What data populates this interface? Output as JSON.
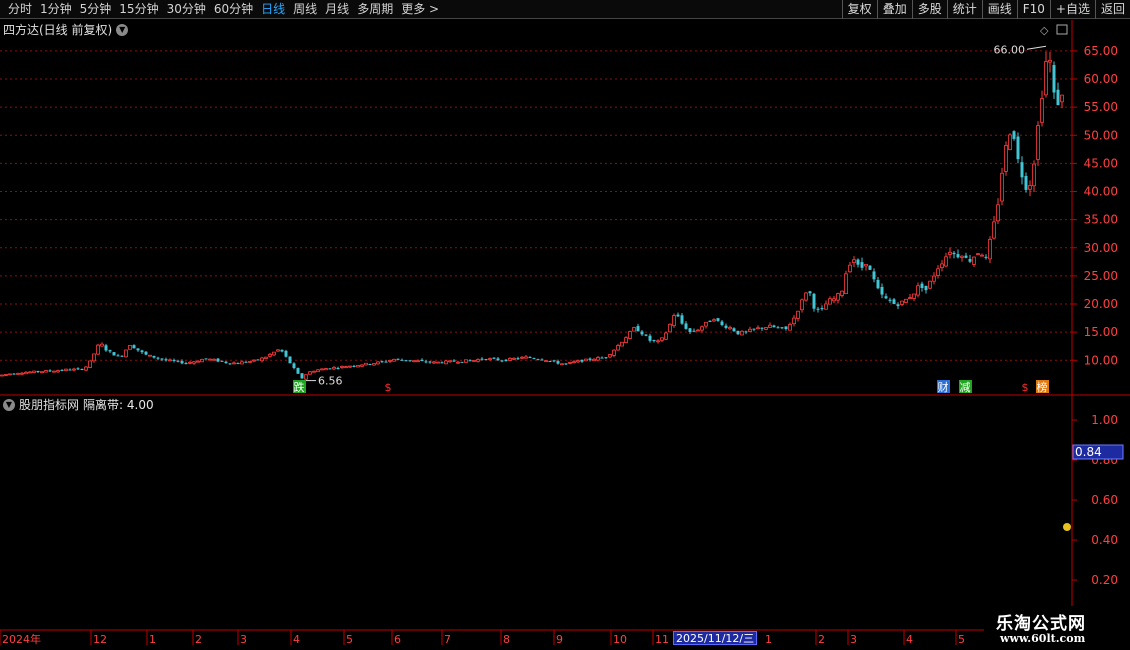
{
  "toolbar": {
    "periods": [
      "分时",
      "1分钟",
      "5分钟",
      "15分钟",
      "30分钟",
      "60分钟",
      "日线",
      "周线",
      "月线",
      "多周期",
      "更多 >"
    ],
    "active_period": "日线",
    "actions": [
      "复权",
      "叠加",
      "多股",
      "统计",
      "画线",
      "F10",
      "+自选",
      "返回"
    ]
  },
  "main_chart": {
    "title": "四方达(日线 前复权)",
    "high_label": "66.00",
    "low_label": "6.56",
    "markers": [
      {
        "text": "跌",
        "color": "#1fa51f"
      },
      {
        "text": "$",
        "color": "#ff3030"
      },
      {
        "text": "财",
        "color": "#2a6fd8"
      },
      {
        "text": "减",
        "color": "#1fa51f"
      },
      {
        "text": "$",
        "color": "#ff3030"
      },
      {
        "text": "榜",
        "color": "#e07a10"
      }
    ]
  },
  "indicator": {
    "name": "股朋指标网",
    "param_label": "隔离带: 4.00",
    "current_value": "0.84"
  },
  "x_axis": {
    "labels": [
      "2024年",
      "12",
      "1",
      "2",
      "3",
      "4",
      "5",
      "6",
      "7",
      "8",
      "9",
      "10",
      "11",
      "1",
      "2",
      "3",
      "4",
      "5"
    ],
    "cursor_date": "2025/11/12/三"
  },
  "watermark": {
    "line1": "乐淘公式网",
    "line2": "www.60lt.com"
  },
  "colors": {
    "up": "#ff3b3b",
    "down": "#42c6d6",
    "grid": "#8a1010",
    "axis": "#c00000",
    "active": "#2aa8ff"
  },
  "chart_data": [
    {
      "type": "candlestick",
      "title": "四方达(日线 前复权)",
      "ylim": [
        4,
        68
      ],
      "y_ticks": [
        10,
        15,
        20,
        25,
        30,
        35,
        40,
        45,
        50,
        55,
        60,
        65
      ],
      "y_tick_labels": [
        "10.00",
        "15.00",
        "20.00",
        "25.00",
        "30.00",
        "35.00",
        "40.00",
        "45.00",
        "50.00",
        "55.00",
        "60.00",
        "65.00"
      ],
      "price_path": [
        [
          0,
          7.3
        ],
        [
          10,
          7.6
        ],
        [
          20,
          7.8
        ],
        [
          30,
          7.9
        ],
        [
          40,
          8.0
        ],
        [
          50,
          8.1
        ],
        [
          60,
          8.2
        ],
        [
          70,
          8.4
        ],
        [
          80,
          8.3
        ],
        [
          88,
          9.0
        ],
        [
          95,
          11.5
        ],
        [
          100,
          13.2
        ],
        [
          105,
          12.0
        ],
        [
          112,
          11.2
        ],
        [
          120,
          10.5
        ],
        [
          130,
          12.8
        ],
        [
          138,
          11.8
        ],
        [
          145,
          11.0
        ],
        [
          155,
          10.5
        ],
        [
          165,
          10.0
        ],
        [
          175,
          9.8
        ],
        [
          185,
          9.5
        ],
        [
          195,
          9.8
        ],
        [
          205,
          10.3
        ],
        [
          215,
          10.0
        ],
        [
          225,
          9.6
        ],
        [
          235,
          9.5
        ],
        [
          245,
          9.7
        ],
        [
          255,
          9.9
        ],
        [
          265,
          10.5
        ],
        [
          275,
          11.5
        ],
        [
          280,
          12.0
        ],
        [
          285,
          10.8
        ],
        [
          292,
          9.0
        ],
        [
          298,
          7.5
        ],
        [
          302,
          6.8
        ],
        [
          308,
          7.8
        ],
        [
          315,
          8.2
        ],
        [
          325,
          8.5
        ],
        [
          335,
          8.7
        ],
        [
          345,
          8.9
        ],
        [
          355,
          9.1
        ],
        [
          365,
          9.3
        ],
        [
          375,
          9.5
        ],
        [
          385,
          9.8
        ],
        [
          395,
          10.2
        ],
        [
          405,
          10.0
        ],
        [
          415,
          9.9
        ],
        [
          425,
          9.7
        ],
        [
          435,
          9.6
        ],
        [
          445,
          9.7
        ],
        [
          455,
          9.8
        ],
        [
          465,
          9.9
        ],
        [
          475,
          10.0
        ],
        [
          485,
          10.3
        ],
        [
          495,
          10.1
        ],
        [
          505,
          10.0
        ],
        [
          515,
          10.3
        ],
        [
          525,
          10.5
        ],
        [
          535,
          10.4
        ],
        [
          545,
          10.1
        ],
        [
          555,
          9.6
        ],
        [
          565,
          9.3
        ],
        [
          575,
          9.7
        ],
        [
          585,
          10.0
        ],
        [
          595,
          10.3
        ],
        [
          605,
          10.5
        ],
        [
          612,
          11.5
        ],
        [
          620,
          13.0
        ],
        [
          628,
          14.5
        ],
        [
          635,
          15.8
        ],
        [
          642,
          14.8
        ],
        [
          650,
          13.5
        ],
        [
          660,
          13.2
        ],
        [
          668,
          15.5
        ],
        [
          675,
          18.5
        ],
        [
          682,
          16.5
        ],
        [
          690,
          15.0
        ],
        [
          698,
          15.5
        ],
        [
          706,
          16.5
        ],
        [
          714,
          17.5
        ],
        [
          722,
          16.2
        ],
        [
          730,
          15.8
        ],
        [
          738,
          14.8
        ],
        [
          746,
          15.0
        ],
        [
          754,
          15.5
        ],
        [
          762,
          15.8
        ],
        [
          770,
          16.0
        ],
        [
          778,
          15.7
        ],
        [
          786,
          15.5
        ],
        [
          794,
          17.5
        ],
        [
          802,
          20.5
        ],
        [
          808,
          23.0
        ],
        [
          814,
          19.5
        ],
        [
          820,
          18.5
        ],
        [
          828,
          20.5
        ],
        [
          836,
          21.0
        ],
        [
          842,
          22.5
        ],
        [
          848,
          27.0
        ],
        [
          854,
          28.0
        ],
        [
          860,
          26.0
        ],
        [
          866,
          27.5
        ],
        [
          872,
          25.0
        ],
        [
          878,
          22.5
        ],
        [
          884,
          21.0
        ],
        [
          890,
          20.5
        ],
        [
          896,
          19.8
        ],
        [
          902,
          20.3
        ],
        [
          908,
          21.0
        ],
        [
          914,
          22.0
        ],
        [
          920,
          23.5
        ],
        [
          926,
          22.5
        ],
        [
          932,
          24.5
        ],
        [
          938,
          26.5
        ],
        [
          944,
          28.0
        ],
        [
          950,
          29.5
        ],
        [
          956,
          28.5
        ],
        [
          962,
          29.0
        ],
        [
          968,
          27.5
        ],
        [
          974,
          28.5
        ],
        [
          980,
          29.5
        ],
        [
          986,
          28.0
        ],
        [
          990,
          31.0
        ],
        [
          995,
          35.0
        ],
        [
          1000,
          40.0
        ],
        [
          1004,
          47.0
        ],
        [
          1008,
          48.5
        ],
        [
          1012,
          53.0
        ],
        [
          1016,
          47.0
        ],
        [
          1020,
          44.0
        ],
        [
          1024,
          42.0
        ],
        [
          1028,
          40.0
        ],
        [
          1032,
          43.0
        ],
        [
          1036,
          48.0
        ],
        [
          1040,
          55.0
        ],
        [
          1044,
          60.0
        ],
        [
          1048,
          66.0
        ],
        [
          1052,
          60.0
        ],
        [
          1056,
          54.0
        ],
        [
          1060,
          58.0
        ],
        [
          1063,
          56.0
        ]
      ]
    },
    {
      "type": "line",
      "title": "股朋指标网",
      "ylim": [
        0.1,
        1.1
      ],
      "y_ticks": [
        0.2,
        0.4,
        0.6,
        0.8,
        1.0
      ],
      "y_tick_labels": [
        "0.20",
        "0.40",
        "0.60",
        "0.80",
        "1.00"
      ],
      "current_value": 0.84
    }
  ]
}
